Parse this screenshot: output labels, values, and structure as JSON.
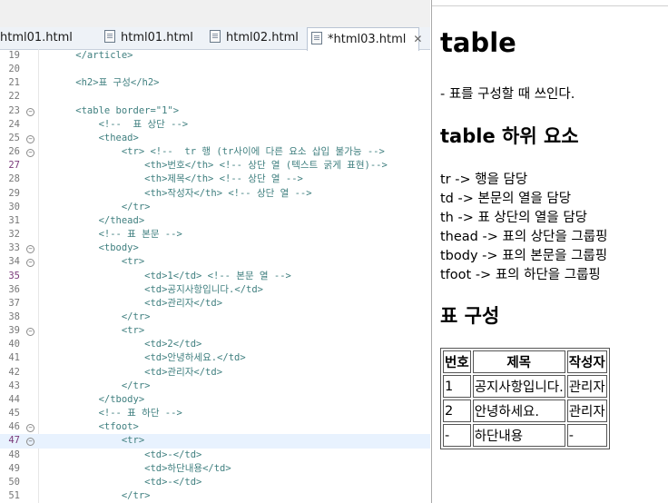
{
  "editor": {
    "tabs": [
      {
        "label": "html01.html",
        "active": false
      },
      {
        "label": "html01.html",
        "active": false
      },
      {
        "label": "html02.html",
        "active": false
      },
      {
        "label": "*html03.html",
        "active": true,
        "close": "✕"
      }
    ],
    "lines": [
      {
        "n": "19",
        "text": "    </article>"
      },
      {
        "n": "20",
        "text": ""
      },
      {
        "n": "21",
        "text": "    <h2>표 구성</h2>"
      },
      {
        "n": "22",
        "text": ""
      },
      {
        "n": "23",
        "text": "    <table border=\"1\">"
      },
      {
        "n": "24",
        "text": "        <!--  표 상단 -->"
      },
      {
        "n": "25",
        "text": "        <thead>"
      },
      {
        "n": "26",
        "text": "            <tr> <!--  tr 행 (tr사이에 다른 요소 삽입 불가능 -->"
      },
      {
        "n": "27",
        "text": "                <th>번호</th> <!-- 상단 열 (텍스트 굵게 표현)-->"
      },
      {
        "n": "28",
        "text": "                <th>제목</th> <!-- 상단 열 -->"
      },
      {
        "n": "29",
        "text": "                <th>작성자</th> <!-- 상단 열 -->"
      },
      {
        "n": "30",
        "text": "            </tr>"
      },
      {
        "n": "31",
        "text": "        </thead>"
      },
      {
        "n": "32",
        "text": "        <!-- 표 본문 -->"
      },
      {
        "n": "33",
        "text": "        <tbody>"
      },
      {
        "n": "34",
        "text": "            <tr>"
      },
      {
        "n": "35",
        "text": "                <td>1</td> <!-- 본문 열 -->"
      },
      {
        "n": "36",
        "text": "                <td>공지사항입니다.</td>"
      },
      {
        "n": "37",
        "text": "                <td>관리자</td>"
      },
      {
        "n": "38",
        "text": "            </tr>"
      },
      {
        "n": "39",
        "text": "            <tr>"
      },
      {
        "n": "40",
        "text": "                <td>2</td>"
      },
      {
        "n": "41",
        "text": "                <td>안녕하세요.</td>"
      },
      {
        "n": "42",
        "text": "                <td>관리자</td>"
      },
      {
        "n": "43",
        "text": "            </tr>"
      },
      {
        "n": "44",
        "text": "        </tbody>"
      },
      {
        "n": "45",
        "text": "        <!-- 표 하단 -->"
      },
      {
        "n": "46",
        "text": "        <tfoot>"
      },
      {
        "n": "47",
        "text": "            <tr>"
      },
      {
        "n": "48",
        "text": "                <td>-</td>"
      },
      {
        "n": "49",
        "text": "                <td>하단내용</td>"
      },
      {
        "n": "50",
        "text": "                <td>-</td>"
      },
      {
        "n": "51",
        "text": "            </tr>"
      }
    ]
  },
  "preview": {
    "title": "table",
    "description": "- 표를 구성할 때 쓰인다.",
    "subheading": "table 하위 요소",
    "items": [
      "tr -> 행을 담당",
      "td -> 본문의 열을 담당",
      "th -> 표 상단의 열을 담당",
      "thead -> 표의 상단을 그룹핑",
      "tbody -> 표의 본문을 그룹핑",
      "tfoot -> 표의 하단을 그룹핑"
    ],
    "table_heading": "표 구성",
    "table": {
      "headers": [
        "번호",
        "제목",
        "작성자"
      ],
      "rows": [
        [
          "1",
          "공지사항입니다.",
          "관리자"
        ],
        [
          "2",
          "안녕하세요.",
          "관리자"
        ],
        [
          "-",
          "하단내용",
          "-"
        ]
      ]
    }
  }
}
